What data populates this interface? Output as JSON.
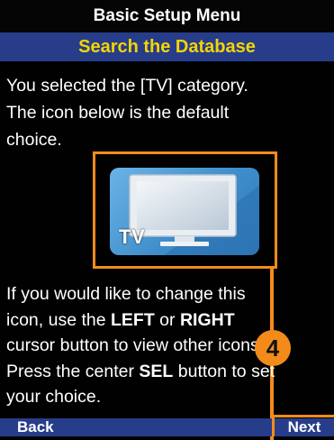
{
  "header": {
    "title": "Basic Setup Menu",
    "subtitle": "Search the Database"
  },
  "description": {
    "lines": [
      "You selected the [TV] category.",
      "The icon below is the default",
      "choice."
    ]
  },
  "icon": {
    "name": "tv-icon",
    "label": "TV"
  },
  "help": {
    "line1_pre": "If you would like to change this",
    "line2_pre": "icon, use the ",
    "line2_left": "LEFT",
    "line2_mid": " or ",
    "line2_right": "RIGHT",
    "line3": "cursor button to view other icons.",
    "line4_pre": "Press the center ",
    "line4_sel": "SEL",
    "line4_post": " button to set",
    "line5": "your choice."
  },
  "annotation": {
    "badge": "4"
  },
  "softkeys": {
    "back": "Back",
    "next": "Next"
  },
  "colors": {
    "bar_blue": "#273d8a",
    "title_yellow": "#f5d400",
    "annotation_orange": "#f38b1b",
    "tile_blue": "#3f8ecb"
  }
}
